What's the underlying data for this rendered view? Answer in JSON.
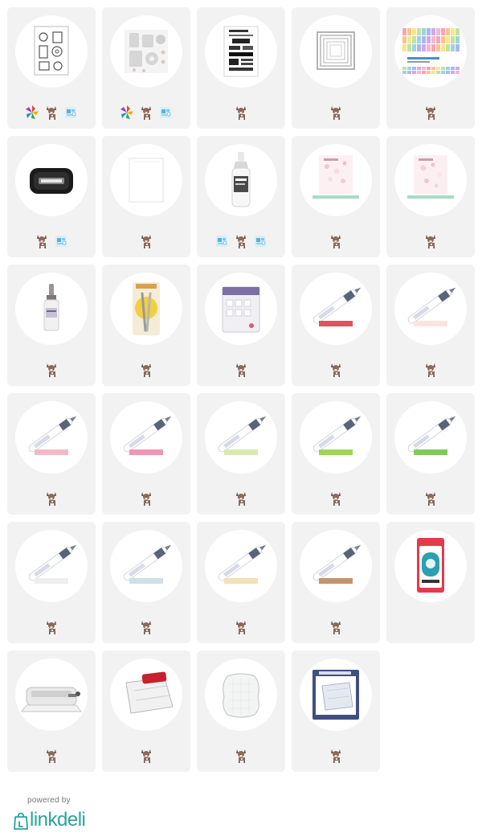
{
  "colors": {
    "card_bg": "#f2f2f2",
    "thumb_bg": "#ffffff",
    "brand_teal": "#2aa39a",
    "footer_text": "#777777"
  },
  "products": [
    {
      "image": "coffee-stamp-set",
      "badges": [
        "affiliate-logo-colorful",
        "dog-icon",
        "store-icon"
      ]
    },
    {
      "image": "coffee-die-set",
      "badges": [
        "affiliate-logo-colorful",
        "dog-icon",
        "store-icon"
      ]
    },
    {
      "image": "espresso-text-stamps",
      "badges": [
        "dog-icon"
      ]
    },
    {
      "image": "nested-rectangle-dies",
      "badges": [
        "dog-icon"
      ]
    },
    {
      "image": "patterned-paper-pad",
      "badges": [
        "dog-icon"
      ]
    },
    {
      "image": "black-ink-pad",
      "badges": [
        "dog-icon",
        "store-icon"
      ]
    },
    {
      "image": "white-cardstock",
      "badges": [
        "dog-icon"
      ]
    },
    {
      "image": "glossy-accents-bottle",
      "badges": [
        "store-icon",
        "dog-icon",
        "store-icon"
      ]
    },
    {
      "image": "sequin-mix-1",
      "badges": [
        "dog-icon"
      ]
    },
    {
      "image": "sequin-mix-2",
      "badges": [
        "dog-icon"
      ]
    },
    {
      "image": "ink-refill-bottle",
      "badges": [
        "dog-icon"
      ]
    },
    {
      "image": "craft-tweezers",
      "badges": [
        "dog-icon"
      ]
    },
    {
      "image": "foam-adhesive-pack",
      "badges": [
        "dog-icon"
      ]
    },
    {
      "image": "marker-red",
      "badges": [
        "dog-icon"
      ],
      "swatch": "#e0505e"
    },
    {
      "image": "marker-pale-pink",
      "badges": [
        "dog-icon"
      ],
      "swatch": "#fbe4e0"
    },
    {
      "image": "marker-light-pink",
      "badges": [
        "dog-icon"
      ],
      "swatch": "#f4b9c6"
    },
    {
      "image": "marker-pink",
      "badges": [
        "dog-icon"
      ],
      "swatch": "#ef96b4"
    },
    {
      "image": "marker-pale-green",
      "badges": [
        "dog-icon"
      ],
      "swatch": "#d9eab0"
    },
    {
      "image": "marker-green",
      "badges": [
        "dog-icon"
      ],
      "swatch": "#9fd45c"
    },
    {
      "image": "marker-bright-green",
      "badges": [
        "dog-icon"
      ],
      "swatch": "#7fcb5a"
    },
    {
      "image": "marker-blender",
      "badges": [
        "dog-icon"
      ],
      "swatch": "#f4f4f4"
    },
    {
      "image": "marker-pale-blue",
      "badges": [
        "dog-icon"
      ],
      "swatch": "#cfe0e6"
    },
    {
      "image": "marker-cream",
      "badges": [
        "dog-icon"
      ],
      "swatch": "#f4e0b8"
    },
    {
      "image": "marker-tan",
      "badges": [
        "dog-icon"
      ],
      "swatch": "#c4946a"
    },
    {
      "image": "tape-runner",
      "badges": []
    },
    {
      "image": "die-cut-machine",
      "badges": [
        "dog-icon"
      ]
    },
    {
      "image": "paper-trimmer",
      "badges": [
        "dog-icon"
      ]
    },
    {
      "image": "acrylic-stamp-block",
      "badges": [
        "dog-icon"
      ]
    },
    {
      "image": "cutting-mat-package",
      "badges": [
        "dog-icon"
      ]
    }
  ],
  "footer": {
    "powered_by": "powered by",
    "brand": "linkdeli"
  }
}
